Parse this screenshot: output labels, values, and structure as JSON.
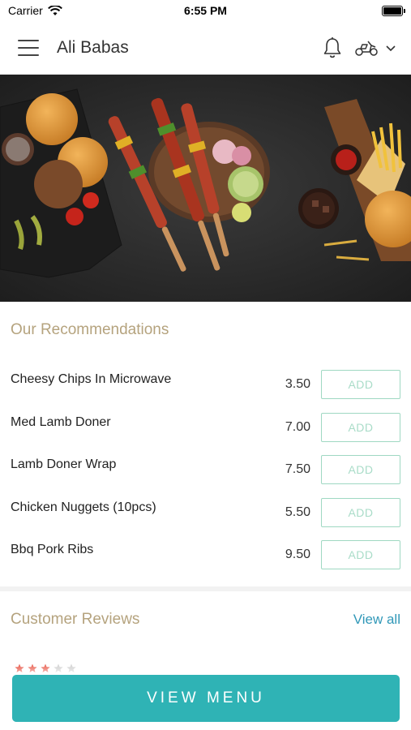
{
  "status_bar": {
    "carrier": "Carrier",
    "time": "6:55 PM"
  },
  "header": {
    "title": "Ali Babas"
  },
  "recommendations": {
    "title": "Our Recommendations",
    "items": [
      {
        "name": "Cheesy Chips In Microwave",
        "price": "3.50",
        "button": "ADD"
      },
      {
        "name": "Med Lamb Doner",
        "price": "7.00",
        "button": "ADD"
      },
      {
        "name": "Lamb Doner Wrap",
        "price": "7.50",
        "button": "ADD"
      },
      {
        "name": "Chicken Nuggets (10pcs)",
        "price": "5.50",
        "button": "ADD"
      },
      {
        "name": "Bbq Pork Ribs",
        "price": "9.50",
        "button": "ADD"
      }
    ]
  },
  "reviews": {
    "title": "Customer Reviews",
    "view_all": "View all"
  },
  "footer": {
    "view_menu": "VIEW MENU"
  },
  "colors": {
    "accent": "#2fb3b5",
    "section_title": "#b5a37e",
    "add_border": "#9fd8c2",
    "link": "#3198b8"
  },
  "icons": [
    "wifi-icon",
    "battery-icon",
    "hamburger-menu-icon",
    "bell-icon",
    "scooter-icon",
    "chevron-down-icon",
    "star-icon"
  ]
}
